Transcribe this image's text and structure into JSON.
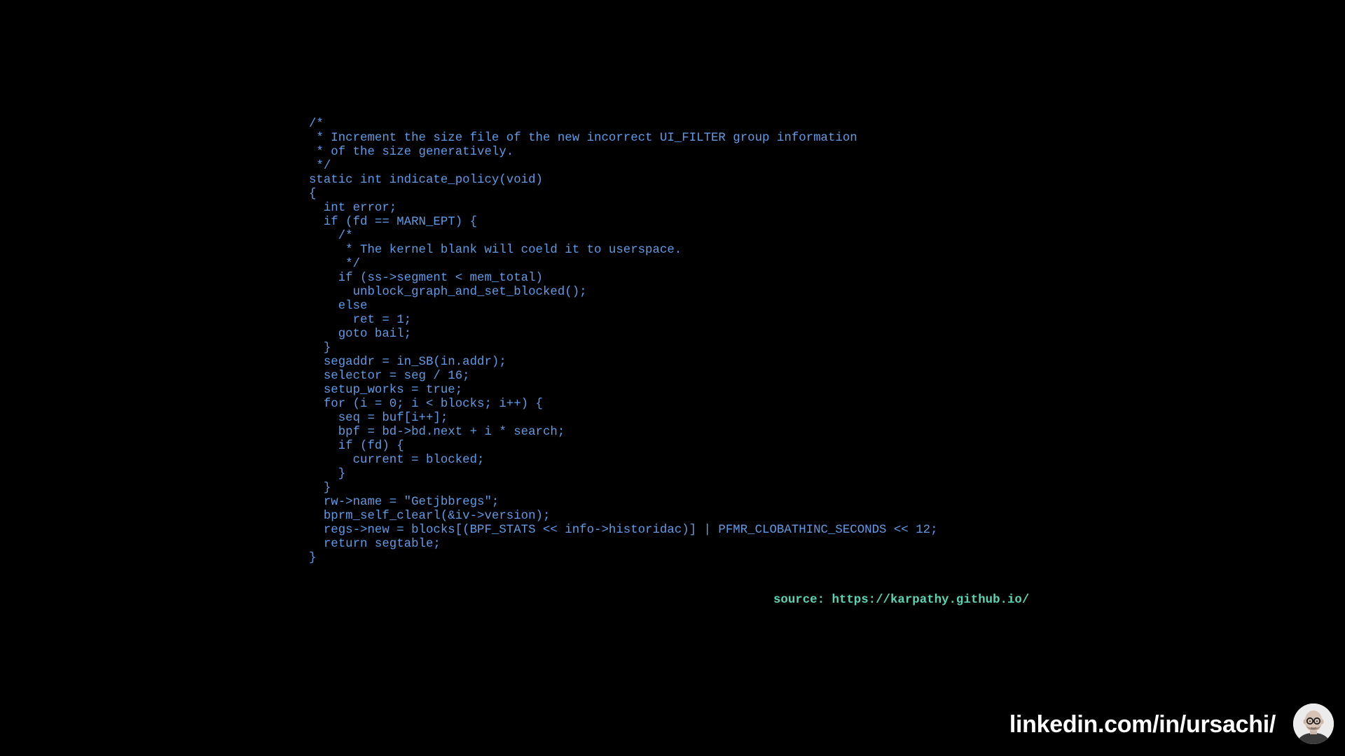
{
  "code": {
    "lines": [
      "/*",
      " * Increment the size file of the new incorrect UI_FILTER group information",
      " * of the size generatively.",
      " */",
      "static int indicate_policy(void)",
      "{",
      "  int error;",
      "  if (fd == MARN_EPT) {",
      "    /*",
      "     * The kernel blank will coeld it to userspace.",
      "     */",
      "    if (ss->segment < mem_total)",
      "      unblock_graph_and_set_blocked();",
      "    else",
      "      ret = 1;",
      "    goto bail;",
      "  }",
      "  segaddr = in_SB(in.addr);",
      "  selector = seg / 16;",
      "  setup_works = true;",
      "  for (i = 0; i < blocks; i++) {",
      "    seq = buf[i++];",
      "    bpf = bd->bd.next + i * search;",
      "    if (fd) {",
      "      current = blocked;",
      "    }",
      "  }",
      "  rw->name = \"Getjbbregs\";",
      "  bprm_self_clearl(&iv->version);",
      "  regs->new = blocks[(BPF_STATS << info->historidac)] | PFMR_CLOBATHINC_SECONDS << 12;",
      "  return segtable;",
      "}"
    ],
    "color": "#5f9be6"
  },
  "source": {
    "text": "source: https://karpathy.github.io/",
    "color": "#58d3b4"
  },
  "footer": {
    "linkedin": "linkedin.com/in/ursachi/",
    "avatar_icon": "person-portrait-icon"
  }
}
